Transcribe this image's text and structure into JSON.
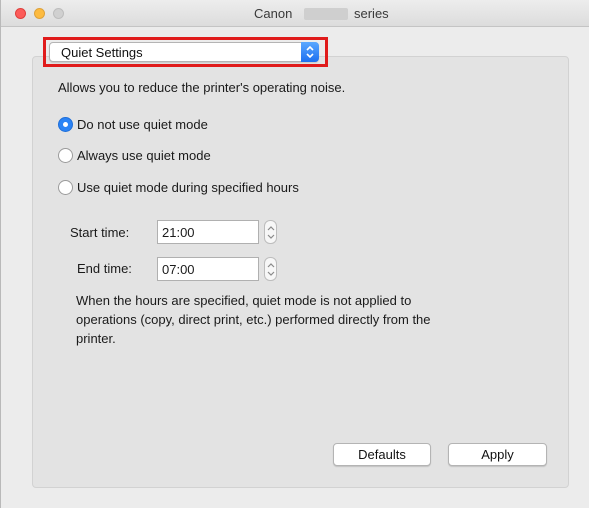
{
  "window": {
    "title_left": "Canon",
    "title_right": "series"
  },
  "popup": {
    "selected": "Quiet Settings",
    "accent_color": "#1c6ff0",
    "highlight_color": "#e01b1b"
  },
  "description": "Allows you to reduce the printer's operating noise.",
  "radio_options": [
    {
      "label": "Do not use quiet mode",
      "checked": true
    },
    {
      "label": "Always use quiet mode",
      "checked": false
    },
    {
      "label": "Use quiet mode during specified hours",
      "checked": false
    }
  ],
  "start_time": {
    "label": "Start time:",
    "value": "21:00"
  },
  "end_time": {
    "label": "End time:",
    "value": "07:00"
  },
  "note": "When the hours are specified, quiet mode is not applied to operations (copy, direct print, etc.) performed directly from the printer.",
  "buttons": {
    "defaults": "Defaults",
    "apply": "Apply"
  }
}
